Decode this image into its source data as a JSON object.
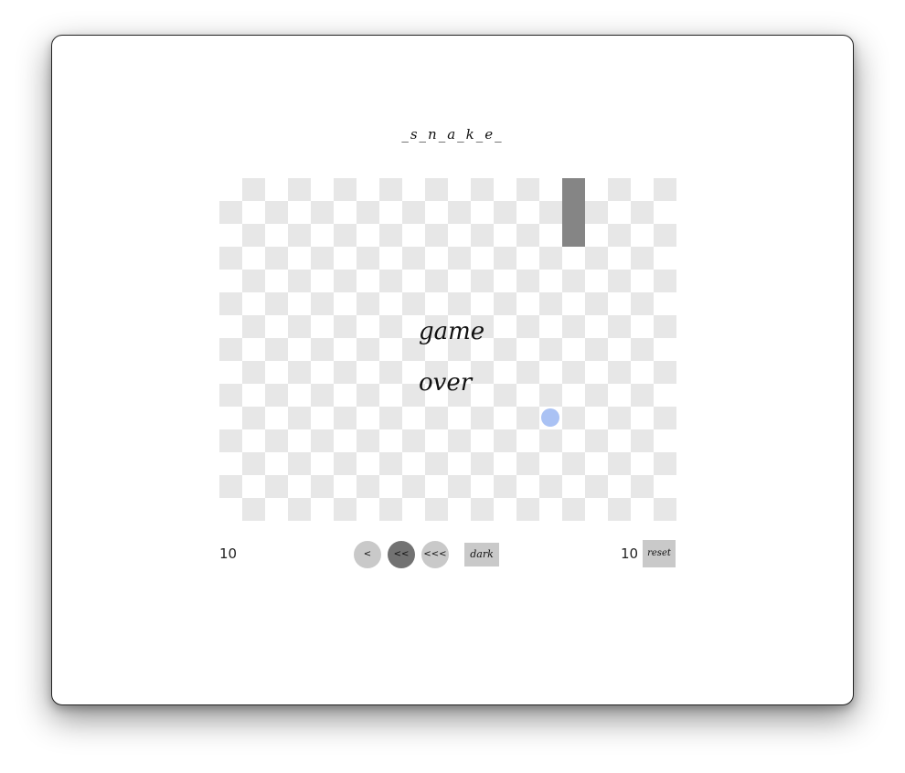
{
  "title": "_s_n_a_k_e_",
  "board": {
    "overlay_line1": "game",
    "overlay_line2": "over"
  },
  "colors": {
    "snake": "#858585",
    "food": "#aac2f4",
    "checker": "#e7e7e7",
    "button": "#c9c9c9",
    "button_active": "#727272"
  },
  "score": {
    "current": "10",
    "best": "10"
  },
  "speed_buttons": [
    {
      "label": "<",
      "active": false
    },
    {
      "label": "<<",
      "active": true
    },
    {
      "label": "<<<",
      "active": false
    }
  ],
  "dark_label": "dark",
  "reset_label": "reset"
}
